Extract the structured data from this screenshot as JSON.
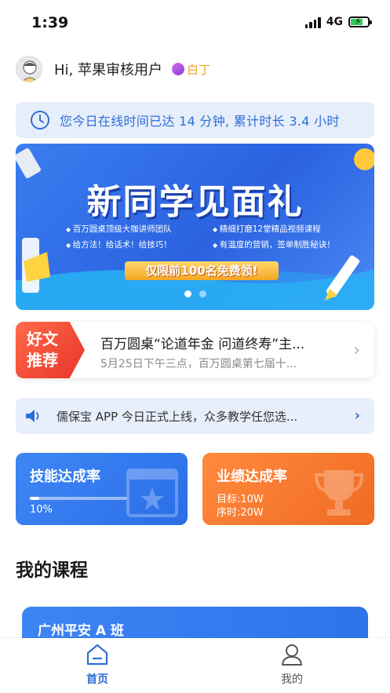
{
  "status_bar": {
    "time": "1:39",
    "network": "4G",
    "battery_level": 0.75
  },
  "greeting": {
    "text": "Hi, 苹果审核用户",
    "badge": "白丁"
  },
  "online_time": {
    "text": "您今日在线时间已达 14 分钟, 累计时长 3.4 小时",
    "icon": "clock-icon"
  },
  "banner": {
    "title": "新同学见面礼",
    "bullets": [
      "百万圆桌顶级大咖讲师团队",
      "精细打磨12堂精品视频课程",
      "给方法！给话术！给技巧！",
      "有温度的营销，签单制胜秘诀！"
    ],
    "promo": "仅限前100名免费领!",
    "dots": 2,
    "active_dot": 0
  },
  "article": {
    "tag": "好文推荐",
    "title": "百万圆桌“论道年金 问道终寿”主...",
    "subtitle": "5月25日下午三点，百万圆桌第七届十..."
  },
  "notice": {
    "text": "儒保宝 APP 今日正式上线，众多教学任您选...",
    "icon": "speaker-icon"
  },
  "skill_card": {
    "title": "技能达成率",
    "percent_label": "10%",
    "progress": 0.1
  },
  "performance_card": {
    "title": "业绩达成率",
    "target": "目标:10W",
    "period": "序时:20W"
  },
  "my_courses": {
    "title": "我的课程",
    "course_name": "广州平安 A 班"
  },
  "tab_bar": {
    "home_label": "首页",
    "mine_label": "我的"
  },
  "colors": {
    "primary": "#2f6fd6",
    "orange": "#f06a22",
    "badge": "#f0a020",
    "tag_red": "#e8342a"
  }
}
